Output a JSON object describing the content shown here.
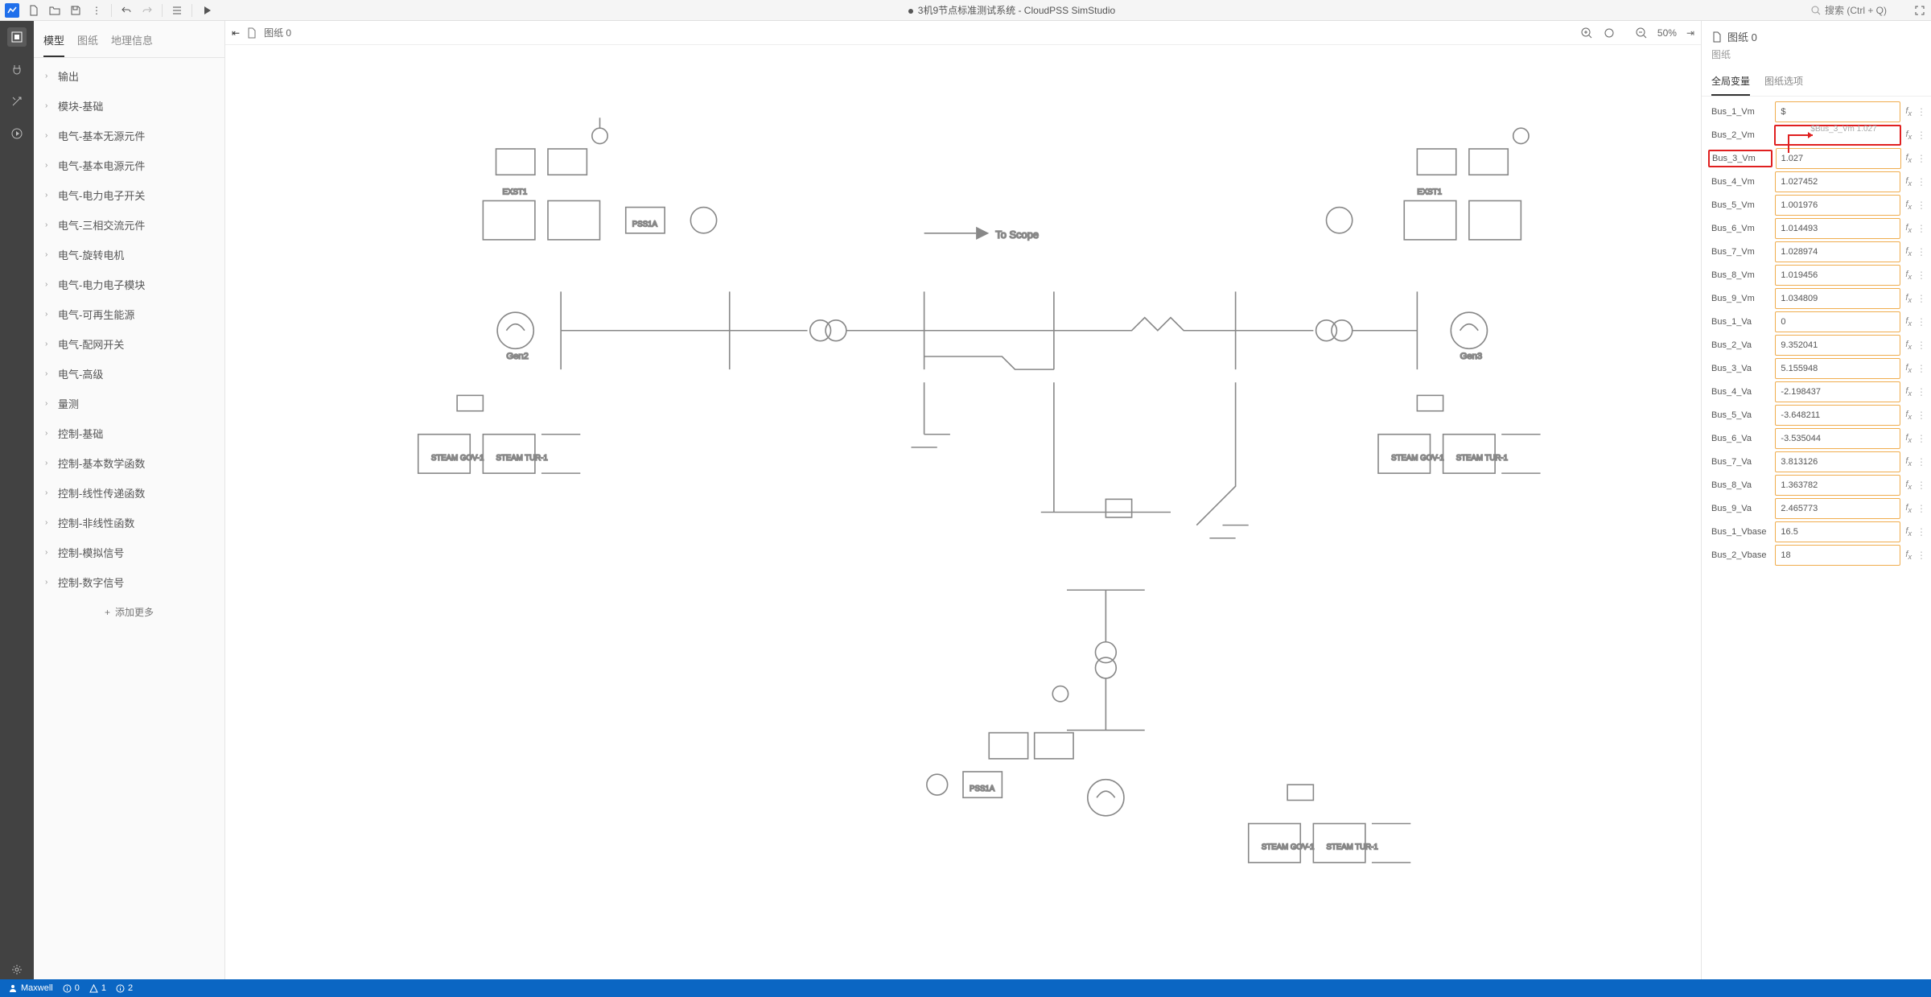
{
  "app": {
    "title_prefix": "● ",
    "title": "3机9节点标准测试系统 - CloudPSS SimStudio",
    "search_placeholder": "搜索 (Ctrl + Q)"
  },
  "left_tabs": [
    "模型",
    "图纸",
    "地理信息"
  ],
  "left_active_tab": 0,
  "left_items": [
    "输出",
    "模块-基础",
    "电气-基本无源元件",
    "电气-基本电源元件",
    "电气-电力电子开关",
    "电气-三相交流元件",
    "电气-旋转电机",
    "电气-电力电子模块",
    "电气-可再生能源",
    "电气-配网开关",
    "电气-高级",
    "量测",
    "控制-基础",
    "控制-基本数学函数",
    "控制-线性传递函数",
    "控制-非线性函数",
    "控制-模拟信号",
    "控制-数字信号"
  ],
  "left_add_more": "添加更多",
  "canvas": {
    "doc_label": "图纸 0",
    "zoom": "50%"
  },
  "right": {
    "head": "图纸 0",
    "sub": "图纸",
    "tabs": [
      "全局变量",
      "图纸选项"
    ],
    "active_tab": 0,
    "tooltip_text": "$Bus_3_Vm 1.027",
    "vars": [
      {
        "name": "Bus_1_Vm",
        "val": "$"
      },
      {
        "name": "Bus_2_Vm",
        "val": "",
        "highlight_inp": true
      },
      {
        "name": "Bus_3_Vm",
        "val": "1.027",
        "highlight_lbl": true
      },
      {
        "name": "Bus_4_Vm",
        "val": "1.027452"
      },
      {
        "name": "Bus_5_Vm",
        "val": "1.001976"
      },
      {
        "name": "Bus_6_Vm",
        "val": "1.014493"
      },
      {
        "name": "Bus_7_Vm",
        "val": "1.028974"
      },
      {
        "name": "Bus_8_Vm",
        "val": "1.019456"
      },
      {
        "name": "Bus_9_Vm",
        "val": "1.034809"
      },
      {
        "name": "Bus_1_Va",
        "val": "0"
      },
      {
        "name": "Bus_2_Va",
        "val": "9.352041"
      },
      {
        "name": "Bus_3_Va",
        "val": "5.155948"
      },
      {
        "name": "Bus_4_Va",
        "val": "-2.198437"
      },
      {
        "name": "Bus_5_Va",
        "val": "-3.648211"
      },
      {
        "name": "Bus_6_Va",
        "val": "-3.535044"
      },
      {
        "name": "Bus_7_Va",
        "val": "3.813126"
      },
      {
        "name": "Bus_8_Va",
        "val": "1.363782"
      },
      {
        "name": "Bus_9_Va",
        "val": "2.465773"
      },
      {
        "name": "Bus_1_Vbase",
        "val": "16.5"
      },
      {
        "name": "Bus_2_Vbase",
        "val": "18"
      }
    ]
  },
  "status": {
    "user": "Maxwell",
    "info": "0",
    "warn": "1",
    "info2": "2"
  }
}
